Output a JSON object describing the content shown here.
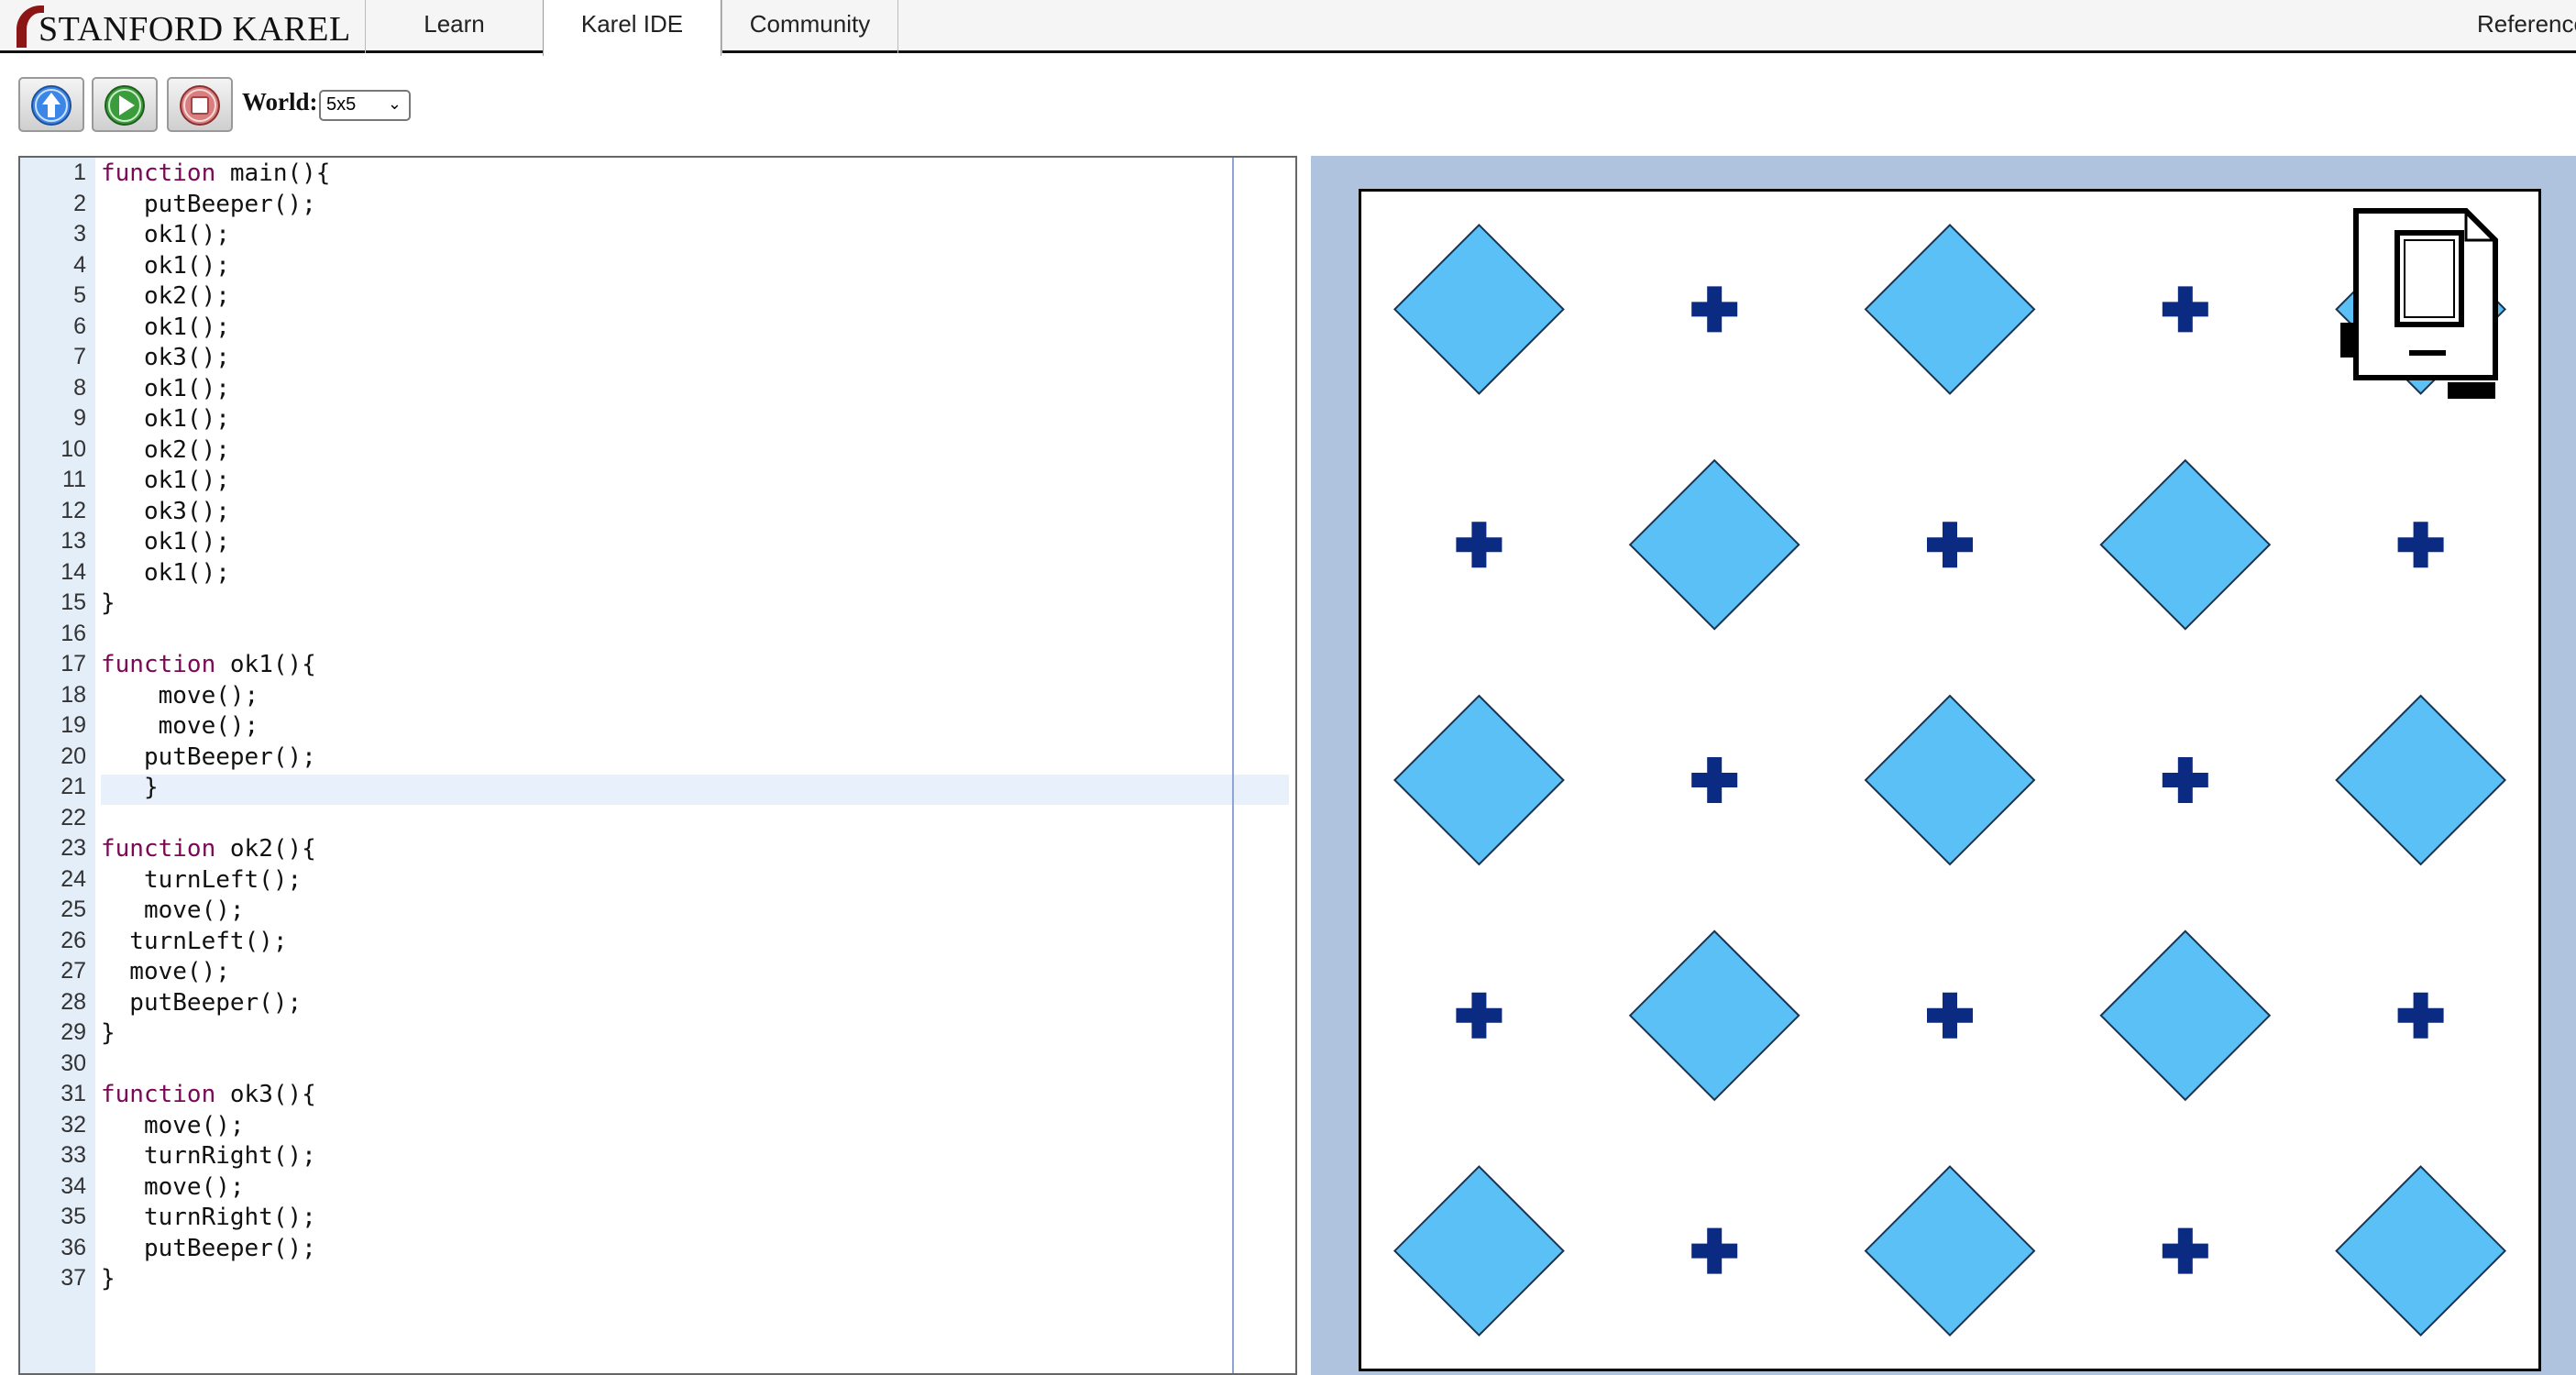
{
  "nav": {
    "logo_text": "STANFORD KAREL",
    "tabs": [
      {
        "label": "Learn"
      },
      {
        "label": "Karel IDE",
        "active": true
      },
      {
        "label": "Community"
      }
    ],
    "reference_label": "Reference"
  },
  "toolbar": {
    "move_icon": "up-arrow-icon",
    "run_icon": "play-icon",
    "stop_icon": "stop-icon",
    "world_label": "World:",
    "world_value": "5x5"
  },
  "editor": {
    "active_line": 21,
    "lines": [
      {
        "n": "1",
        "kw": "function",
        "rest": " main(){"
      },
      {
        "n": "2",
        "kw": "",
        "rest": "   putBeeper();"
      },
      {
        "n": "3",
        "kw": "",
        "rest": "   ok1();"
      },
      {
        "n": "4",
        "kw": "",
        "rest": "   ok1();"
      },
      {
        "n": "5",
        "kw": "",
        "rest": "   ok2();"
      },
      {
        "n": "6",
        "kw": "",
        "rest": "   ok1();"
      },
      {
        "n": "7",
        "kw": "",
        "rest": "   ok3();"
      },
      {
        "n": "8",
        "kw": "",
        "rest": "   ok1();"
      },
      {
        "n": "9",
        "kw": "",
        "rest": "   ok1();"
      },
      {
        "n": "10",
        "kw": "",
        "rest": "   ok2();"
      },
      {
        "n": "11",
        "kw": "",
        "rest": "   ok1();"
      },
      {
        "n": "12",
        "kw": "",
        "rest": "   ok3();"
      },
      {
        "n": "13",
        "kw": "",
        "rest": "   ok1();"
      },
      {
        "n": "14",
        "kw": "",
        "rest": "   ok1();"
      },
      {
        "n": "15",
        "kw": "",
        "rest": "}"
      },
      {
        "n": "16",
        "kw": "",
        "rest": ""
      },
      {
        "n": "17",
        "kw": "function",
        "rest": " ok1(){"
      },
      {
        "n": "18",
        "kw": "",
        "rest": "    move();"
      },
      {
        "n": "19",
        "kw": "",
        "rest": "    move();"
      },
      {
        "n": "20",
        "kw": "",
        "rest": "   putBeeper();"
      },
      {
        "n": "21",
        "kw": "",
        "rest": "   }"
      },
      {
        "n": "22",
        "kw": "",
        "rest": ""
      },
      {
        "n": "23",
        "kw": "function",
        "rest": " ok2(){"
      },
      {
        "n": "24",
        "kw": "",
        "rest": "   turnLeft();"
      },
      {
        "n": "25",
        "kw": "",
        "rest": "   move();"
      },
      {
        "n": "26",
        "kw": "",
        "rest": "  turnLeft();"
      },
      {
        "n": "27",
        "kw": "",
        "rest": "  move();"
      },
      {
        "n": "28",
        "kw": "",
        "rest": "  putBeeper();"
      },
      {
        "n": "29",
        "kw": "",
        "rest": "}"
      },
      {
        "n": "30",
        "kw": "",
        "rest": ""
      },
      {
        "n": "31",
        "kw": "function",
        "rest": " ok3(){"
      },
      {
        "n": "32",
        "kw": "",
        "rest": "   move();"
      },
      {
        "n": "33",
        "kw": "",
        "rest": "   turnRight();"
      },
      {
        "n": "34",
        "kw": "",
        "rest": "   move();"
      },
      {
        "n": "35",
        "kw": "",
        "rest": "   turnRight();"
      },
      {
        "n": "36",
        "kw": "",
        "rest": "   putBeeper();"
      },
      {
        "n": "37",
        "kw": "",
        "rest": "}"
      }
    ]
  },
  "world": {
    "rows": 5,
    "cols": 5,
    "beeper_color": "#5bc0f5",
    "corner_color": "#0b2a82",
    "cells": [
      [
        "beeper",
        "corner",
        "beeper",
        "corner",
        "beeper"
      ],
      [
        "corner",
        "beeper",
        "corner",
        "beeper",
        "corner"
      ],
      [
        "beeper",
        "corner",
        "beeper",
        "corner",
        "beeper"
      ],
      [
        "corner",
        "beeper",
        "corner",
        "beeper",
        "corner"
      ],
      [
        "beeper",
        "corner",
        "beeper",
        "corner",
        "beeper"
      ]
    ],
    "karel": {
      "row": 1,
      "col": 5,
      "facing": "east"
    }
  }
}
